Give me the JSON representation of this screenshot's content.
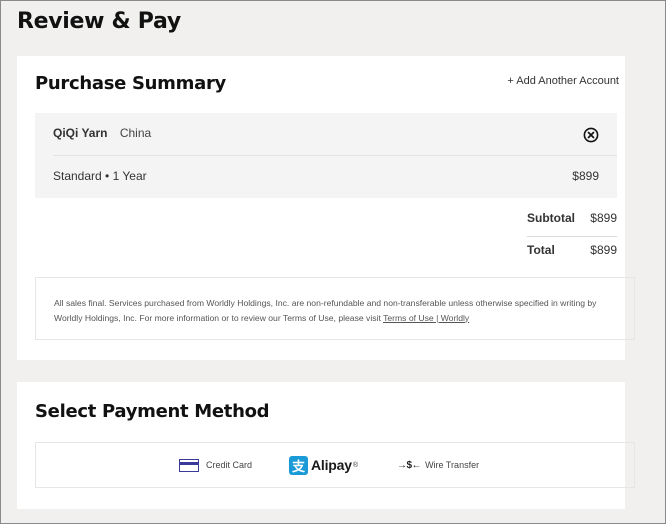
{
  "page": {
    "title": "Review & Pay"
  },
  "summary": {
    "title": "Purchase Summary",
    "add_account": "+ Add Another Account",
    "item": {
      "company": "QiQi Yarn",
      "country": "China",
      "plan": "Standard • 1 Year",
      "price": "$899",
      "remove_icon": "close-circle-icon"
    },
    "subtotal_label": "Subtotal",
    "subtotal_value": "$899",
    "total_label": "Total",
    "total_value": "$899",
    "disclaimer_text": "All sales final. Services purchased from Worldly Holdings, Inc. are non-refundable and non-transferable unless otherwise specified in writing by Worldly Holdings, Inc. For more information or to review our Terms of Use, please visit ",
    "terms_link": "Terms of Use | Worldly"
  },
  "payment": {
    "title": "Select Payment Method",
    "options": [
      {
        "label": "Credit Card",
        "icon": "credit-card-icon"
      },
      {
        "label": "Alipay",
        "icon": "alipay-icon",
        "glyph": "支",
        "tm": "®"
      },
      {
        "label": "Wire Transfer",
        "icon": "wire-transfer-icon",
        "glyph": "→$←"
      }
    ]
  },
  "colors": {
    "page_bg": "#f1f0ee",
    "card_bg": "#ffffff",
    "alipay_blue": "#1a9bd8",
    "card_stroke": "#3a3a9a"
  }
}
